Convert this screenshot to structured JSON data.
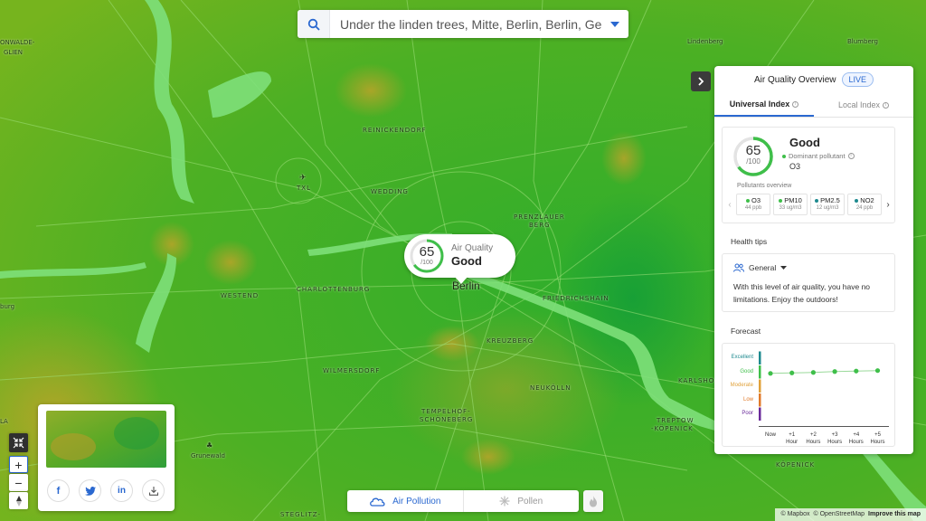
{
  "search": {
    "value": "Under the linden trees, Mitte, Berlin, Berlin, Ger"
  },
  "map": {
    "labels": {
      "hermsdorf": "ONWALDE-",
      "hermsdorf2": "GLIEN",
      "lindenberg": "Lindenberg",
      "blumberg": "Blumberg",
      "reinickendorf": "REINICKENDORF",
      "txl": "TXL",
      "wedding": "WEDDING",
      "prenzlauer": "PRENZLAUER",
      "prenzlauer2": "BERG",
      "westend": "WESTEND",
      "charlottenburg": "CHARLOTTENBURG",
      "berlin": "Berlin",
      "friedrichshain": "FRIEDRICHSHAIN",
      "kreuzberg": "KREUZBERG",
      "wilmersdorf": "WILMERSDORF",
      "neukolln": "NEUKÖLLN",
      "karlshorst": "KARLSHORST",
      "tempelhof": "TEMPELHOF-",
      "tempelhof2": "SCHÖNEBERG",
      "treptow": "TREPTOW",
      "treptow2": "-KÖPENICK",
      "grunewald": "Grunewald",
      "kopenick": "KÖPENICK",
      "steglitz": "STEGLITZ-",
      "left_edge": "burg",
      "left_edge2": "LA"
    }
  },
  "bubble": {
    "value": "65",
    "max": "/100",
    "label": "Air Quality",
    "status": "Good"
  },
  "panel": {
    "title": "Air Quality Overview",
    "live": "LIVE",
    "tabs": [
      {
        "label": "Universal Index"
      },
      {
        "label": "Local Index"
      }
    ],
    "aqi": {
      "value": "65",
      "max": "/100",
      "status": "Good",
      "dominant_label": "Dominant pollutant",
      "dominant_value": "O3",
      "progress": 0.65
    },
    "pollutants_title": "Pollutants overview",
    "pollutants": [
      {
        "name": "O3",
        "value": "44 ppb"
      },
      {
        "name": "PM10",
        "value": "33 ug/m3"
      },
      {
        "name": "PM2.5",
        "value": "12 ug/m3"
      },
      {
        "name": "NO2",
        "value": "24 ppb"
      }
    ],
    "health_title": "Health tips",
    "health_group": "General",
    "health_text": "With this level of air quality, you have no limitations. Enjoy the outdoors!",
    "forecast_title": "Forecast",
    "forecast": {
      "categories": [
        "Excellent",
        "Good",
        "Moderate",
        "Low",
        "Poor"
      ],
      "category_colors": [
        "#1e8a8f",
        "#3fbf4a",
        "#e0a13a",
        "#e07a2a",
        "#6a2a9a"
      ],
      "ticks": [
        {
          "l1": "Now",
          "l2": ""
        },
        {
          "l1": "+1",
          "l2": "Hour"
        },
        {
          "l1": "+2",
          "l2": "Hours"
        },
        {
          "l1": "+3",
          "l2": "Hours"
        },
        {
          "l1": "+4",
          "l2": "Hours"
        },
        {
          "l1": "+5",
          "l2": "Hours"
        }
      ],
      "values": [
        62,
        63,
        64,
        66,
        67,
        68
      ]
    }
  },
  "share": {
    "buttons": [
      "f",
      "t",
      "in",
      "dl"
    ]
  },
  "controls": {
    "zoom_in": "+",
    "zoom_out": "−"
  },
  "layers": [
    {
      "label": "Air Pollution"
    },
    {
      "label": "Pollen"
    }
  ],
  "attribution": {
    "mapbox": "© Mapbox",
    "osm": "© OpenStreetMap",
    "improve": "Improve this map"
  },
  "colors": {
    "accent": "#2a68d0",
    "good": "#3fbf4a",
    "map_green": "#3fae2a"
  }
}
